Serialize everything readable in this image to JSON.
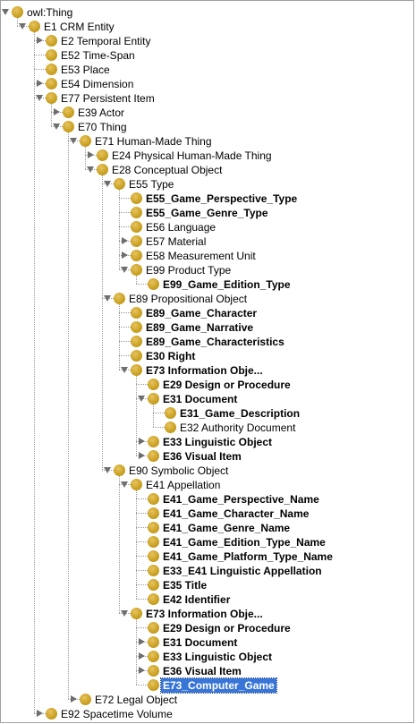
{
  "tree": {
    "nodes": [
      {
        "label": "owl:Thing",
        "bold": false,
        "expanded": true
      },
      {
        "label": "E1 CRM Entity",
        "bold": false,
        "expanded": true
      },
      {
        "label": "E2 Temporal Entity",
        "bold": false,
        "expanded": false
      },
      {
        "label": "E52 Time-Span",
        "bold": false
      },
      {
        "label": "E53 Place",
        "bold": false
      },
      {
        "label": "E54 Dimension",
        "bold": false,
        "expanded": false
      },
      {
        "label": "E77 Persistent Item",
        "bold": false,
        "expanded": true
      },
      {
        "label": "E39 Actor",
        "bold": false,
        "expanded": false
      },
      {
        "label": "E70 Thing",
        "bold": false,
        "expanded": true
      },
      {
        "label": "E71 Human-Made Thing",
        "bold": false,
        "expanded": true
      },
      {
        "label": "E24 Physical Human-Made Thing",
        "bold": false,
        "expanded": false
      },
      {
        "label": "E28 Conceptual Object",
        "bold": false,
        "expanded": true
      },
      {
        "label": "E55 Type",
        "bold": false,
        "expanded": true
      },
      {
        "label": "E55_Game_Perspective_Type",
        "bold": true
      },
      {
        "label": "E55_Game_Genre_Type",
        "bold": true
      },
      {
        "label": "E56 Language",
        "bold": false
      },
      {
        "label": "E57 Material",
        "bold": false,
        "expanded": false
      },
      {
        "label": "E58 Measurement Unit",
        "bold": false,
        "expanded": false
      },
      {
        "label": "E99 Product Type",
        "bold": false,
        "expanded": true
      },
      {
        "label": "E99_Game_Edition_Type",
        "bold": true
      },
      {
        "label": "E89 Propositional Object",
        "bold": false,
        "expanded": true
      },
      {
        "label": "E89_Game_Character",
        "bold": true
      },
      {
        "label": "E89_Game_Narrative",
        "bold": true
      },
      {
        "label": "E89_Game_Characteristics",
        "bold": true
      },
      {
        "label": "E30 Right",
        "bold": true
      },
      {
        "label": "E73 Information Obje...",
        "bold": true,
        "expanded": true
      },
      {
        "label": "E29 Design or Procedure",
        "bold": true
      },
      {
        "label": "E31 Document",
        "bold": true,
        "expanded": true
      },
      {
        "label": "E31_Game_Description",
        "bold": true
      },
      {
        "label": "E32 Authority Document",
        "bold": false
      },
      {
        "label": "E33 Linguistic Object",
        "bold": true,
        "expanded": false
      },
      {
        "label": "E36 Visual Item",
        "bold": true,
        "expanded": false
      },
      {
        "label": "E90 Symbolic Object",
        "bold": false,
        "expanded": true
      },
      {
        "label": "E41 Appellation",
        "bold": false,
        "expanded": true
      },
      {
        "label": "E41_Game_Perspective_Name",
        "bold": true
      },
      {
        "label": "E41_Game_Character_Name",
        "bold": true
      },
      {
        "label": "E41_Game_Genre_Name",
        "bold": true
      },
      {
        "label": "E41_Game_Edition_Type_Name",
        "bold": true
      },
      {
        "label": "E41_Game_Platform_Type_Name",
        "bold": true
      },
      {
        "label": "E33_E41 Linguistic Appellation",
        "bold": true
      },
      {
        "label": "E35 Title",
        "bold": true
      },
      {
        "label": "E42 Identifier",
        "bold": true
      },
      {
        "label": "E73 Information Obje...",
        "bold": true,
        "expanded": true
      },
      {
        "label": "E29 Design or Procedure",
        "bold": true
      },
      {
        "label": "E31 Document",
        "bold": true,
        "expanded": false
      },
      {
        "label": "E33 Linguistic Object",
        "bold": true,
        "expanded": false
      },
      {
        "label": "E36 Visual Item",
        "bold": true,
        "expanded": false
      },
      {
        "label": "E73_Computer_Game",
        "bold": true,
        "selected": true
      },
      {
        "label": "E72 Legal Object",
        "bold": false,
        "expanded": false
      },
      {
        "label": "E92 Spacetime Volume",
        "bold": false,
        "expanded": false
      }
    ]
  }
}
